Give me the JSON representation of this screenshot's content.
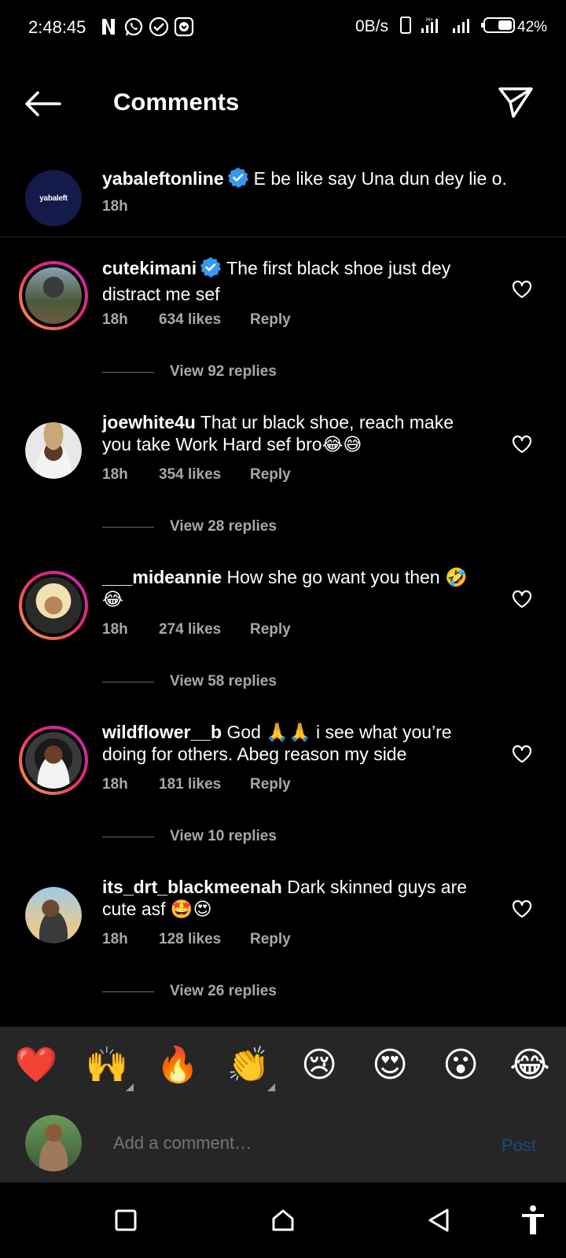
{
  "status_bar": {
    "time": "2:48:45",
    "net_speed": "0B/s",
    "battery": "42%"
  },
  "header": {
    "title": "Comments"
  },
  "caption": {
    "username": "yabaleftonline",
    "avatar_text": "yabaleft",
    "text": "E be like say Una dun dey lie o.",
    "time": "18h"
  },
  "comments": [
    {
      "username": "cutekimani",
      "verified": true,
      "text": "The first black shoe just dey distract me sef",
      "time": "18h",
      "likes": "634 likes",
      "reply_label": "Reply",
      "view_replies": "View 92 replies"
    },
    {
      "username": "joewhite4u",
      "verified": false,
      "text": "That ur black shoe, reach make you take Work Hard sef bro😂😅",
      "time": "18h",
      "likes": "354 likes",
      "reply_label": "Reply",
      "view_replies": "View 28 replies"
    },
    {
      "username": "___mideannie",
      "verified": false,
      "text": "How she go want you then 🤣😂",
      "time": "18h",
      "likes": "274 likes",
      "reply_label": "Reply",
      "view_replies": "View 58 replies"
    },
    {
      "username": "wildflower__b",
      "verified": false,
      "text": "God 🙏🙏 i see what you’re doing for others.  Abeg reason my side",
      "time": "18h",
      "likes": "181 likes",
      "reply_label": "Reply",
      "view_replies": "View 10 replies"
    },
    {
      "username": "its_drt_blackmeenah",
      "verified": false,
      "text": "Dark skinned guys are cute asf 🤩😍",
      "time": "18h",
      "likes": "128 likes",
      "reply_label": "Reply",
      "view_replies": "View 26 replies"
    }
  ],
  "reactions": [
    "❤️",
    "🙌",
    "🔥",
    "👏",
    "😢",
    "😍",
    "😮",
    "😂"
  ],
  "composer": {
    "placeholder": "Add a comment…",
    "post_label": "Post"
  },
  "colors": {
    "background": "#000000",
    "muted_text": "#a8a8a8",
    "bar_background": "#262626",
    "verified_blue": "#3897f0",
    "post_disabled": "#1c4a7a"
  }
}
